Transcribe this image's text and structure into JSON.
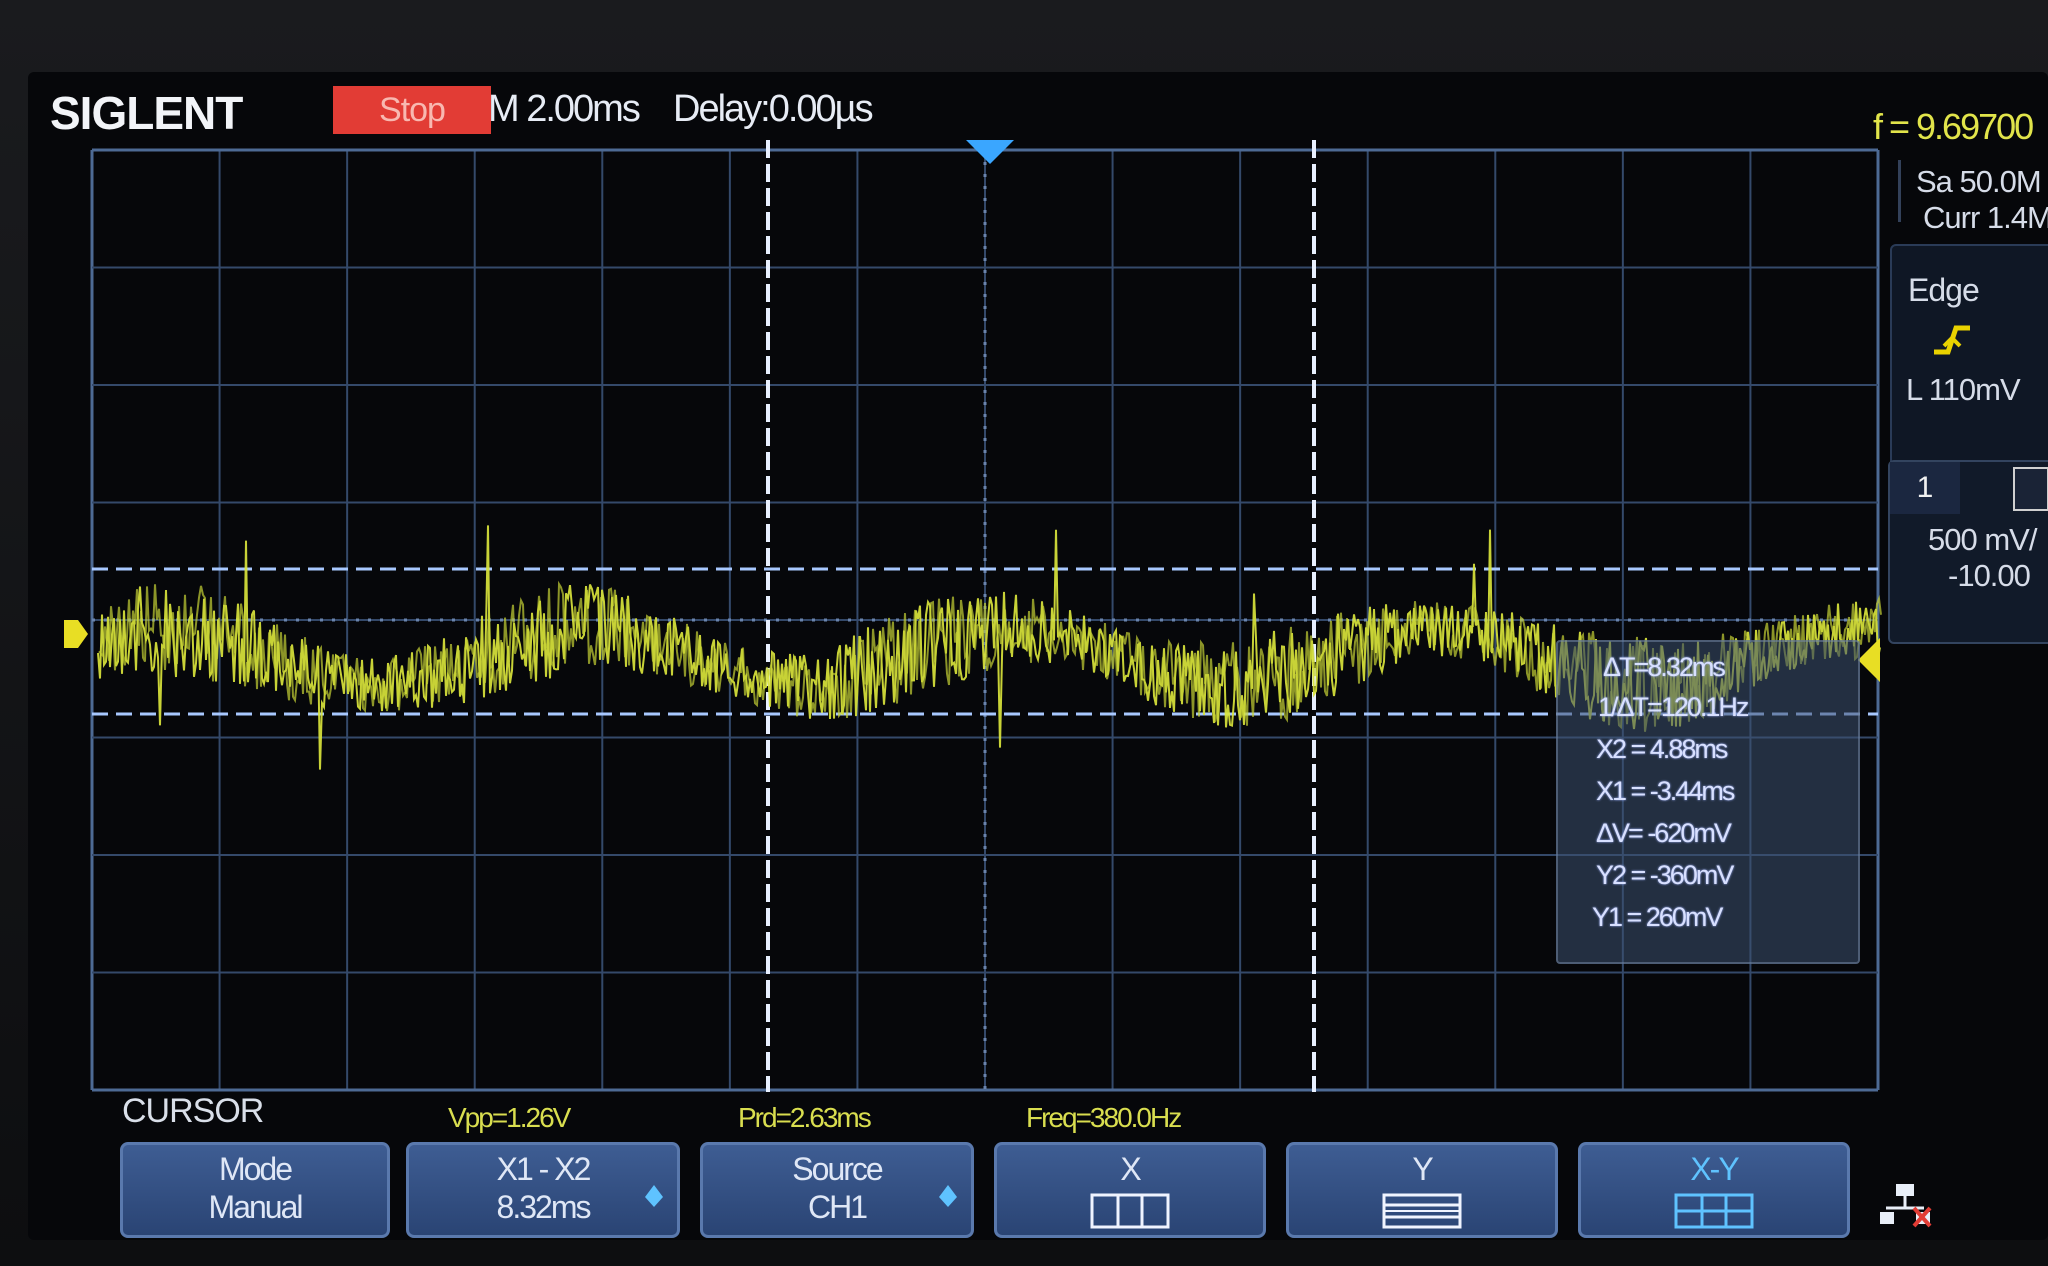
{
  "header": {
    "brand": "SIGLENT",
    "run_state": "Stop",
    "timebase": "M 2.00ms",
    "delay": "Delay:0.00µs",
    "frequency": "f = 9.69700"
  },
  "right_panel": {
    "sample_rate": "Sa 50.0M",
    "memory": "Curr 1.4M",
    "trigger_type": "Edge",
    "trigger_level": "L  110mV",
    "channel": "1",
    "volts_per_div": "500 mV/",
    "offset": "-10.00"
  },
  "cursor_readout": {
    "delta_t": "ΔT=8.32ms",
    "inv_delta_t": "1/ΔT=120.1Hz",
    "x2": "X2 = 4.88ms",
    "x1": "X1 = -3.44ms",
    "delta_v": "ΔV= -620mV",
    "y2": "Y2 = -360mV",
    "y1": "Y1 = 260mV"
  },
  "measurements": {
    "vpp": "Vpp=1.26V",
    "period": "Prd=2.63ms",
    "freq": "Freq=380.0Hz"
  },
  "menu": {
    "title": "CURSOR",
    "softkeys": [
      {
        "line1": "Mode",
        "line2": "Manual"
      },
      {
        "line1": "X1 - X2",
        "line2": "8.32ms"
      },
      {
        "line1": "Source",
        "line2": "CH1"
      },
      {
        "line1": "X",
        "line2": ""
      },
      {
        "line1": "Y",
        "line2": ""
      },
      {
        "line1": "X-Y",
        "line2": ""
      }
    ]
  },
  "colors": {
    "waveform": "#d9e43c",
    "cursor": "#cfe3ff",
    "grid": "#3b5578",
    "stop_badge": "#e23c35",
    "softkey": "#2f4c80"
  }
}
